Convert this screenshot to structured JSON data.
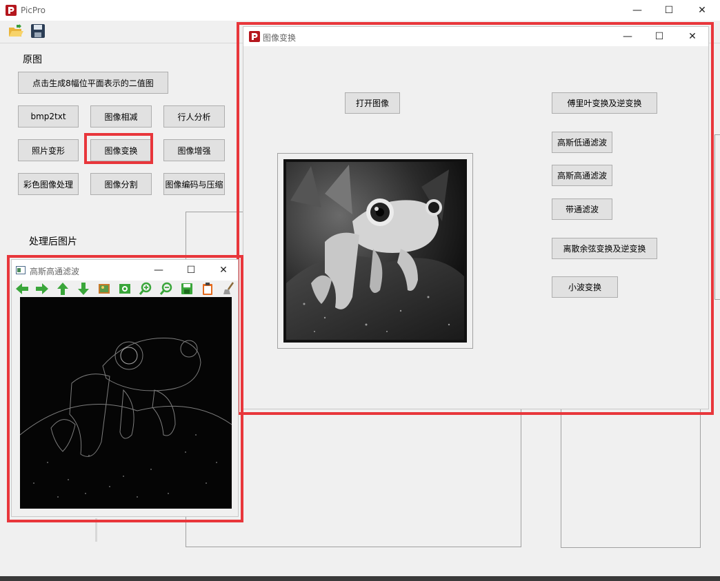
{
  "main_window": {
    "title": "PicPro",
    "label_original": "原图",
    "label_processed": "处理后图片",
    "buttons": {
      "bitplane": "点击生成8幅位平面表示的二值图",
      "bmp2txt": "bmp2txt",
      "subtract": "图像相减",
      "pedestrian": "行人分析",
      "deform": "照片变形",
      "transform": "图像变换",
      "enhance": "图像增强",
      "color": "彩色图像处理",
      "segment": "图像分割",
      "encode": "图像编码与压缩"
    }
  },
  "transform_window": {
    "title": "图像变换",
    "buttons": {
      "open": "打开图像",
      "fourier": "傅里叶变换及逆变换",
      "gauss_low": "高斯低通滤波",
      "gauss_high": "高斯高通滤波",
      "bandpass": "带通滤波",
      "dct": "离散余弦变换及逆变换",
      "wavelet": "小波变换"
    }
  },
  "viewer_window": {
    "title": "高斯高通滤波"
  },
  "colors": {
    "highlight": "#e8363b",
    "button_bg": "#e1e1e1",
    "window_bg": "#f0f0f0",
    "app_icon": "#b5171e"
  }
}
